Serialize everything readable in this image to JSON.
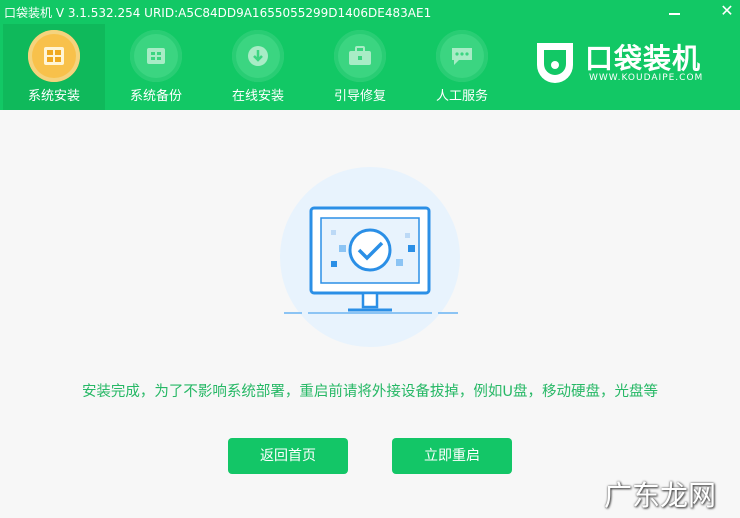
{
  "window": {
    "title": "口袋装机 V 3.1.532.254 URID:A5C84DD9A1655055299D1406DE483AE1",
    "minimize_label": "—",
    "close_label": "✕"
  },
  "nav": {
    "items": [
      {
        "label": "系统安装",
        "icon": "windows-install-icon",
        "active": true
      },
      {
        "label": "系统备份",
        "icon": "backup-icon",
        "active": false
      },
      {
        "label": "在线安装",
        "icon": "download-icon",
        "active": false
      },
      {
        "label": "引导修复",
        "icon": "toolbox-icon",
        "active": false
      },
      {
        "label": "人工服务",
        "icon": "chat-icon",
        "active": false
      }
    ]
  },
  "brand": {
    "name": "口袋装机",
    "url": "WWW.KOUDAIPE.COM"
  },
  "main": {
    "message": "安装完成，为了不影响系统部署，重启前请将外接设备拔掉，例如U盘，移动硬盘，光盘等",
    "home_button": "返回首页",
    "restart_button": "立即重启"
  },
  "watermark": "广东龙网",
  "colors": {
    "primary_green": "#12c865",
    "active_nav": "#f8c14b",
    "illustration_blue": "#2b8fe6"
  }
}
